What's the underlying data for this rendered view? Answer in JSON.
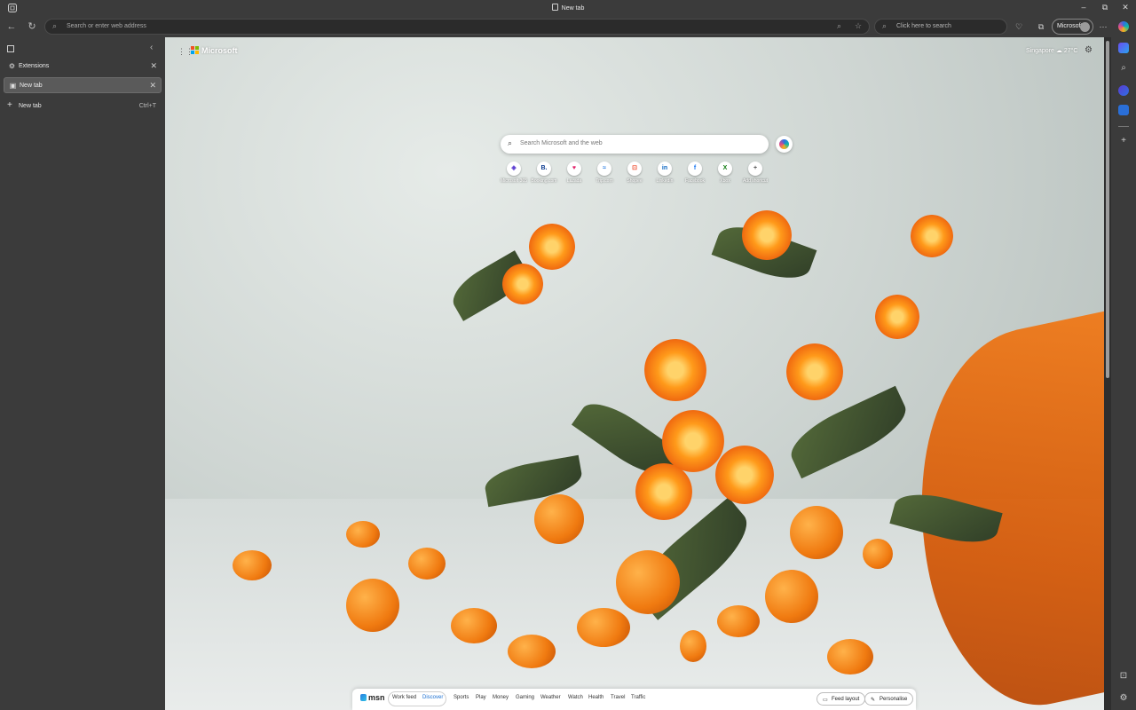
{
  "window": {
    "title": "New tab"
  },
  "toolbar": {
    "address_placeholder": "Search or enter web address",
    "search_placeholder": "Click here to search",
    "profile_label": "Microsoft"
  },
  "sidebar": {
    "tabs": [
      {
        "label": "Extensions",
        "active": false
      },
      {
        "label": "New tab",
        "active": true
      }
    ],
    "new_tab_label": "New tab",
    "new_tab_shortcut": "Ctrl+T"
  },
  "newtab_page": {
    "brand": "Microsoft",
    "weather": {
      "location": "Singapore",
      "temp": "27°C"
    },
    "search_placeholder": "Search Microsoft and the web",
    "quick_links": [
      {
        "label": "Microsoft 365",
        "glyph": "◈",
        "color": "#5a3bd1"
      },
      {
        "label": "Booking.com",
        "glyph": "B.",
        "color": "#0b3b8f"
      },
      {
        "label": "Lazada",
        "glyph": "♥",
        "color": "#e2236a"
      },
      {
        "label": "Trip.com",
        "glyph": "≈",
        "color": "#2a7de1"
      },
      {
        "label": "Shopee",
        "glyph": "⊡",
        "color": "#ee4d2d"
      },
      {
        "label": "LinkedIn",
        "glyph": "in",
        "color": "#0a66c2"
      },
      {
        "label": "Facebook",
        "glyph": "f",
        "color": "#1877f2"
      },
      {
        "label": "Xbox",
        "glyph": "X",
        "color": "#107c10"
      },
      {
        "label": "Add shortcut",
        "glyph": "+",
        "color": "#555555"
      }
    ]
  },
  "msn_bar": {
    "logo": "msn",
    "feed_tabs": [
      "Work feed",
      "Discover"
    ],
    "selected": "Discover",
    "nav": [
      "Sports",
      "Play",
      "Money",
      "Gaming",
      "Weather",
      "Watch",
      "Health",
      "Travel",
      "Traffic"
    ],
    "feed_layout_label": "Feed layout",
    "personalise_label": "Personalise"
  }
}
